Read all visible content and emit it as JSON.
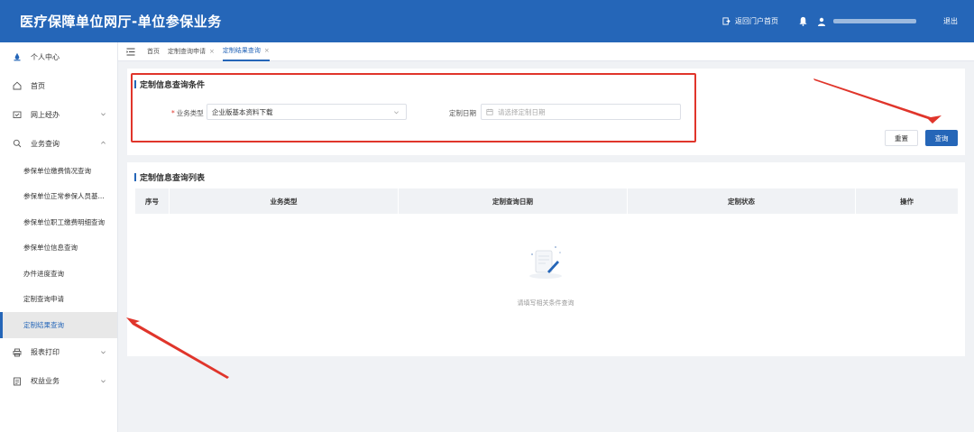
{
  "header": {
    "title": "医疗保障单位网厅-单位参保业务",
    "home_link": "返回门户首页",
    "logout": "退出"
  },
  "sidebar": {
    "personal_center": "个人中心",
    "home": "首页",
    "online_handling": "网上经办",
    "business_query": "业务查询",
    "sub_items": [
      "参保单位缴费情况查询",
      "参保单位正常参保人员基...",
      "参保单位职工缴费明细查询",
      "参保单位信息查询",
      "办件进度查询",
      "定制查询申请",
      "定制结果查询"
    ],
    "report_print": "报表打印",
    "rights_business": "权益业务"
  },
  "tabs": {
    "home": "首页",
    "custom_apply": "定制查询申请",
    "custom_result": "定制结果查询"
  },
  "query_panel": {
    "title": "定制信息查询条件",
    "business_type_label": "业务类型",
    "business_type_value": "企业版基本资料下载",
    "custom_date_label": "定制日期",
    "custom_date_placeholder": "请选择定制日期",
    "reset_button": "重置",
    "query_button": "查询"
  },
  "list_panel": {
    "title": "定制信息查询列表",
    "columns": [
      "序号",
      "业务类型",
      "定制查询日期",
      "定制状态",
      "操作"
    ],
    "empty_text": "请填写相关条件查询"
  },
  "colors": {
    "primary": "#2566b8",
    "annotation": "#e0352b"
  }
}
